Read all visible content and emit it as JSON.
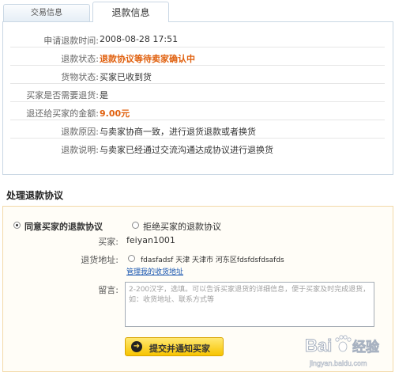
{
  "tabs": {
    "transaction_info": "交易信息",
    "refund_info": "退款信息"
  },
  "refund_info": {
    "rows": [
      {
        "label": "申请退款时间:",
        "value": "2008-08-28 17:51"
      },
      {
        "label": "退款状态:",
        "value": "退款协议等待卖家确认中"
      },
      {
        "label": "货物状态:",
        "value": "买家已收到货"
      },
      {
        "label": "买家是否需要退货:",
        "value": "是"
      },
      {
        "label": "退还给买家的金额:",
        "value": "9.00元"
      },
      {
        "label": "退款原因:",
        "value": "与卖家协商一致，进行退货退款或者换货"
      },
      {
        "label": "退款说明:",
        "value": "与卖家已经通过交流沟通达成协议进行退换货"
      }
    ],
    "highlight_color": "#e0600e"
  },
  "handle": {
    "section_title": "处理退款协议",
    "agree_label": "同意买家的退款协议",
    "reject_label": "拒绝买家的退款协议",
    "buyer_label": "买家:",
    "buyer_value": "feiyan1001",
    "address_label": "退货地址:",
    "address_value": "fdasfadsf 天津 天津市 河东区fdsfdsfdsafds",
    "manage_address_link": "管理我的收货地址",
    "message_label": "留言:",
    "message_placeholder": "2-200汉字，选填。可以告诉买家退货的详细信息，便于买家及时完成退货，如：收货地址、联系方式等",
    "submit_label": "提交并通知买家"
  },
  "watermark": {
    "brand": "Bai",
    "suffix": "经验",
    "domain": "jingyan.baidu.com"
  },
  "colors": {
    "panel_border": "#c9d7e4",
    "handle_border": "#f3d9a8",
    "link": "#1a56b0",
    "button": "#f7c400"
  }
}
